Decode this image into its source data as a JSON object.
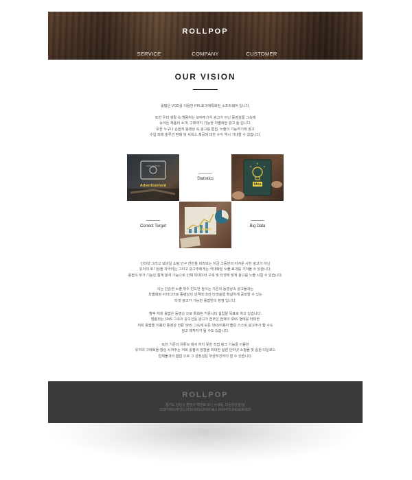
{
  "header": {
    "logo": "ROLLPOP",
    "nav": [
      {
        "label": "SERVICE"
      },
      {
        "label": "COMPANY"
      },
      {
        "label": "CUSTOMER"
      }
    ]
  },
  "vision": {
    "title": "OUR VISION",
    "intro": [
      "롤팝은 VOD를 이용한 PPL효과에특화된 소프트웨어 입니다.",
      "",
      "또한 우리 생활 속 범람하는 보여주기식 광고가 아닌 동영상들 그속에",
      "녹아든 제품의 소개, 구매까지 가능한 차별화된 광고 툴 입니다.",
      "또한 누구나 손쉽게 동영상 속 광고를 편집, 노출이 가능하기에 광고",
      "수입 외에 솔루션 판매 및 서비스 제공에 대한 수익 역시 기대할 수 있습니다."
    ]
  },
  "grid": {
    "advertisement_label": "Advertisement",
    "statistics_label": "Statistics",
    "idea_label": "Idea",
    "correct_target_label": "Correct Target",
    "growth_label": "Growth",
    "big_data_label": "Big Data"
  },
  "body": {
    "p1": [
      "인터넷 그리고 모바일 쇼핑 인구 천만을 바라보는 지금 그동안의 지겨운 사전 광고가 아닌",
      "유저의 호기심을 자극하는 그리고 광고주에게는 극대화된 노출 효과를 가져올 수 있습니다.",
      "롤팝의 부가 기능인 통계 분석 기능으로 인해 빅데이터 구축 및 타겟에 맞게 광고를 노출 시킬 수 있습니다."
    ],
    "p2": [
      "이는 단순한 노출 횟수 빈도만 높이는 기존의 동영상속 광고들과는",
      "차별화된 아이디어로 동영상의 성격에 따라 타겟층을 확실하게 공략할 수 있는",
      "타겟 광고가 가능한 롤팝만의 장점 입니다."
    ],
    "p3": [
      "향후 저희 롤팝은 동영상 으로 특화된 커뮤니티 설립을 목표로 하고 있습니다.",
      "범람하는 SNS 그속의 광고인듯 광고가 전부인 현재의 SNS 형태를 타파한",
      "저희 롤팝을 이용한 동영상 전문 SNS 그속에 모든 SNS이용자 들은 스스로 광고주가 될 수도",
      "광고 제작자가 될 수도 있습니다."
    ],
    "p4": [
      "또한 기존의 유튜브 에서 하지 못한 직접 링크 기능을 이용한",
      "유저의 구매욕을 항상 시켜주는 저희 롤팝의 장점을 최대한 살린 인터넷 쇼핑몰 및 음원 다운로드",
      "업체들과의 협업 으로 그 성장성은 무궁무진하다 할 수 있습니다."
    ]
  },
  "footer": {
    "logo": "ROLLPOP",
    "address": "경기도 성남시 분당구 백현로 97 ( 수내동, 다운타운빌딩)",
    "copyright": "COPYRIGHT(C) 2016 ROLLPOP ALL RIGHTS RESERVED"
  },
  "colors": {
    "footer_bg": "#3a3a3a",
    "accent_yellow": "#f5d04a",
    "title_text": "#222222"
  }
}
